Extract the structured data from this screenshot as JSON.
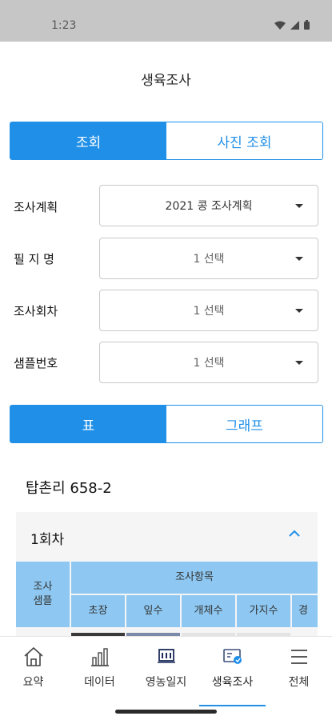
{
  "status": {
    "time": "1:23"
  },
  "header": {
    "title": "생육조사"
  },
  "view_toggle": {
    "options": [
      "조회",
      "사진 조회"
    ],
    "selected": "조회"
  },
  "filters": [
    {
      "label": "조사계획",
      "value": "2021 콩 조사계획"
    },
    {
      "label": "필 지 명",
      "value": "1 선택"
    },
    {
      "label": "조사회차",
      "value": "1 선택"
    },
    {
      "label": "샘플번호",
      "value": "1 선택"
    }
  ],
  "display_toggle": {
    "options": [
      "표",
      "그래프"
    ],
    "selected": "표"
  },
  "location": "탑촌리 658-2",
  "round_card": {
    "title": "1회차",
    "expanded": true
  },
  "table": {
    "row_header": "조사\n샘플",
    "group_header": "조사항목",
    "columns": [
      "초장",
      "잎수",
      "개체수",
      "가지수",
      "경"
    ]
  },
  "tabs": [
    {
      "label": "요약",
      "icon": "home-icon"
    },
    {
      "label": "데이터",
      "icon": "bar-chart-icon"
    },
    {
      "label": "영농일지",
      "icon": "journal-icon"
    },
    {
      "label": "생육조사",
      "icon": "survey-icon",
      "active": true
    },
    {
      "label": "전체",
      "icon": "menu-icon"
    }
  ],
  "colors": {
    "primary": "#1f8fe8",
    "table_header": "#8ec8f2",
    "status_bar": "#c6c6c6"
  }
}
